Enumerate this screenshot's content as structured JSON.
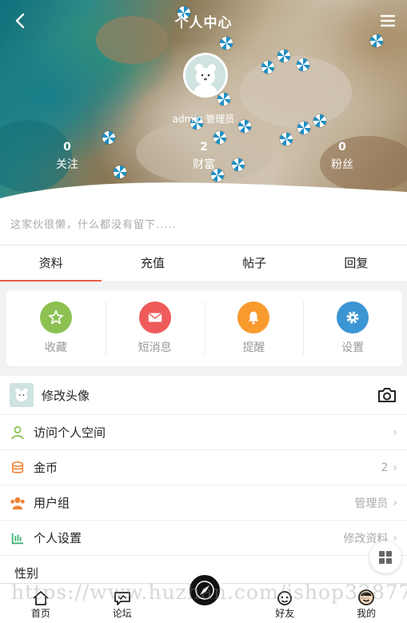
{
  "header": {
    "title": "个人中心",
    "back_icon": "chevron-left-icon",
    "menu_icon": "hamburger-menu-icon"
  },
  "profile": {
    "username": "admin",
    "role": "管理员"
  },
  "stats": [
    {
      "value": "0",
      "label": "关注"
    },
    {
      "value": "2",
      "label": "财富"
    },
    {
      "value": "0",
      "label": "粉丝"
    }
  ],
  "bio": "这家伙很懒，什么都没有留下.....",
  "tabs": [
    "资料",
    "充值",
    "帖子",
    "回复"
  ],
  "quick_actions": [
    {
      "label": "收藏",
      "icon": "star-icon",
      "color": "#8cc152"
    },
    {
      "label": "短消息",
      "icon": "envelope-icon",
      "color": "#ef5a5a"
    },
    {
      "label": "提醒",
      "icon": "bell-icon",
      "color": "#f99a2e"
    },
    {
      "label": "设置",
      "icon": "gear-icon",
      "color": "#3b95d3"
    }
  ],
  "list": [
    {
      "label": "修改头像",
      "value": "",
      "icon": "camera-icon"
    },
    {
      "label": "访问个人空间",
      "value": "",
      "icon": "user-icon"
    },
    {
      "label": "金币",
      "value": "2",
      "icon": "coins-icon"
    },
    {
      "label": "用户组",
      "value": "管理员",
      "icon": "group-icon"
    },
    {
      "label": "个人设置",
      "value": "修改资料",
      "icon": "bars-icon"
    },
    {
      "label": "性别",
      "value": "",
      "icon": ""
    }
  ],
  "bottom_nav": [
    {
      "label": "首页",
      "icon": "home-icon"
    },
    {
      "label": "论坛",
      "icon": "chat-icon"
    },
    {
      "label": "",
      "icon": "compass-icon"
    },
    {
      "label": "好友",
      "icon": "friends-icon"
    },
    {
      "label": "我的",
      "icon": "face-icon"
    }
  ],
  "watermark": "https://www.huzhan.com/ishop32877",
  "colors": {
    "accent": "#e85c4a"
  }
}
